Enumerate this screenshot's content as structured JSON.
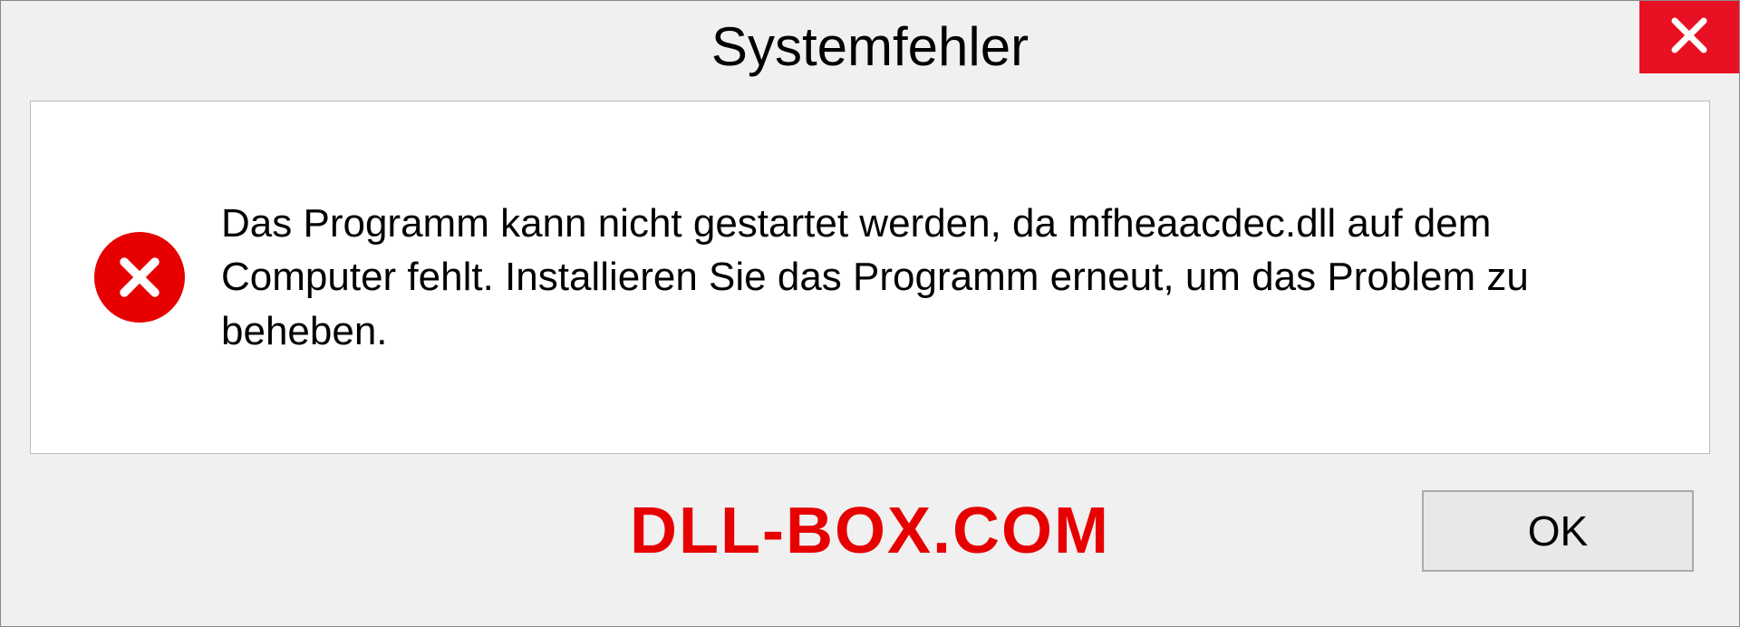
{
  "dialog": {
    "title": "Systemfehler",
    "message": "Das Programm kann nicht gestartet werden, da mfheaacdec.dll auf dem Computer fehlt. Installieren Sie das Programm erneut, um das Problem zu beheben.",
    "ok_label": "OK"
  },
  "watermark": "DLL-BOX.COM"
}
